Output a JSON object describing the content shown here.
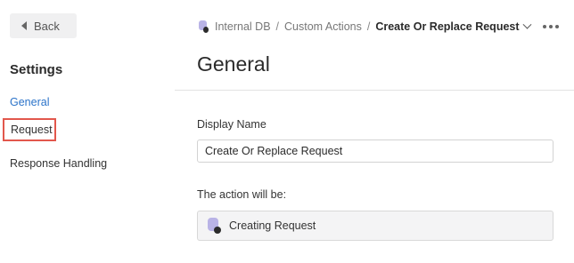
{
  "sidebar": {
    "back_label": "Back",
    "section_title": "Settings",
    "items": [
      {
        "label": "General",
        "active": true
      },
      {
        "label": "Request",
        "highlighted": true
      },
      {
        "label": "Response Handling"
      }
    ]
  },
  "breadcrumb": {
    "items": [
      "Internal DB",
      "Custom Actions"
    ],
    "current": "Create Or Replace Request",
    "separator": "/"
  },
  "main": {
    "title": "General",
    "display_name_label": "Display Name",
    "display_name_value": "Create Or Replace Request",
    "action_label": "The action will be:",
    "action_value": "Creating Request"
  },
  "colors": {
    "accent": "#2b73c9",
    "highlight_border": "#e2574c"
  }
}
